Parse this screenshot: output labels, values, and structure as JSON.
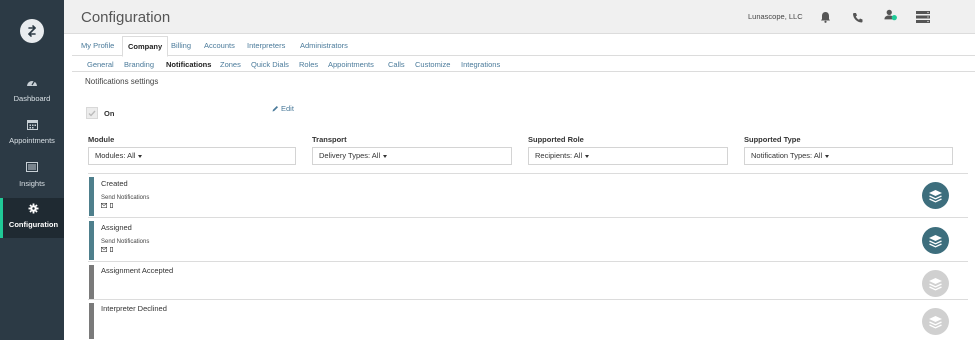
{
  "app": {
    "title": "Configuration",
    "company": "Lunascope, LLC"
  },
  "sidebar": {
    "items": [
      {
        "label": "Dashboard",
        "icon": "dashboard-icon"
      },
      {
        "label": "Appointments",
        "icon": "calendar-icon"
      },
      {
        "label": "Insights",
        "icon": "insights-icon"
      },
      {
        "label": "Configuration",
        "icon": "gear-icon",
        "active": true
      }
    ]
  },
  "tabs": [
    "My Profile",
    "Company",
    "Billing",
    "Accounts",
    "Interpreters",
    "Administrators"
  ],
  "subtabs": [
    "General",
    "Branding",
    "Notifications",
    "Zones",
    "Quick Dials",
    "Roles",
    "Appointments",
    "Calls",
    "Customize",
    "Integrations"
  ],
  "section_title": "Notifications settings",
  "toggle": {
    "label": "On",
    "checked": true
  },
  "edit_label": "Edit",
  "filters": [
    {
      "label": "Module",
      "value": "Modules: All"
    },
    {
      "label": "Transport",
      "value": "Delivery Types: All"
    },
    {
      "label": "Supported Role",
      "value": "Recipients: All"
    },
    {
      "label": "Supported Type",
      "value": "Notification Types: All"
    }
  ],
  "notifications": [
    {
      "name": "Created",
      "sub": "Send Notifications",
      "enabled": true
    },
    {
      "name": "Assigned",
      "sub": "Send Notifications",
      "enabled": true
    },
    {
      "name": "Assignment Accepted",
      "enabled": false
    },
    {
      "name": "Interpreter Declined",
      "enabled": false
    }
  ],
  "colors": {
    "sidebar": "#2c3a45",
    "accent": "#20c997",
    "enabled_bar": "#4e7f8c",
    "disabled_bar": "#7a7a7a",
    "enabled_stack": "#3d6e7d",
    "disabled_stack": "#d0d0d0",
    "link": "#4a7a9a"
  }
}
